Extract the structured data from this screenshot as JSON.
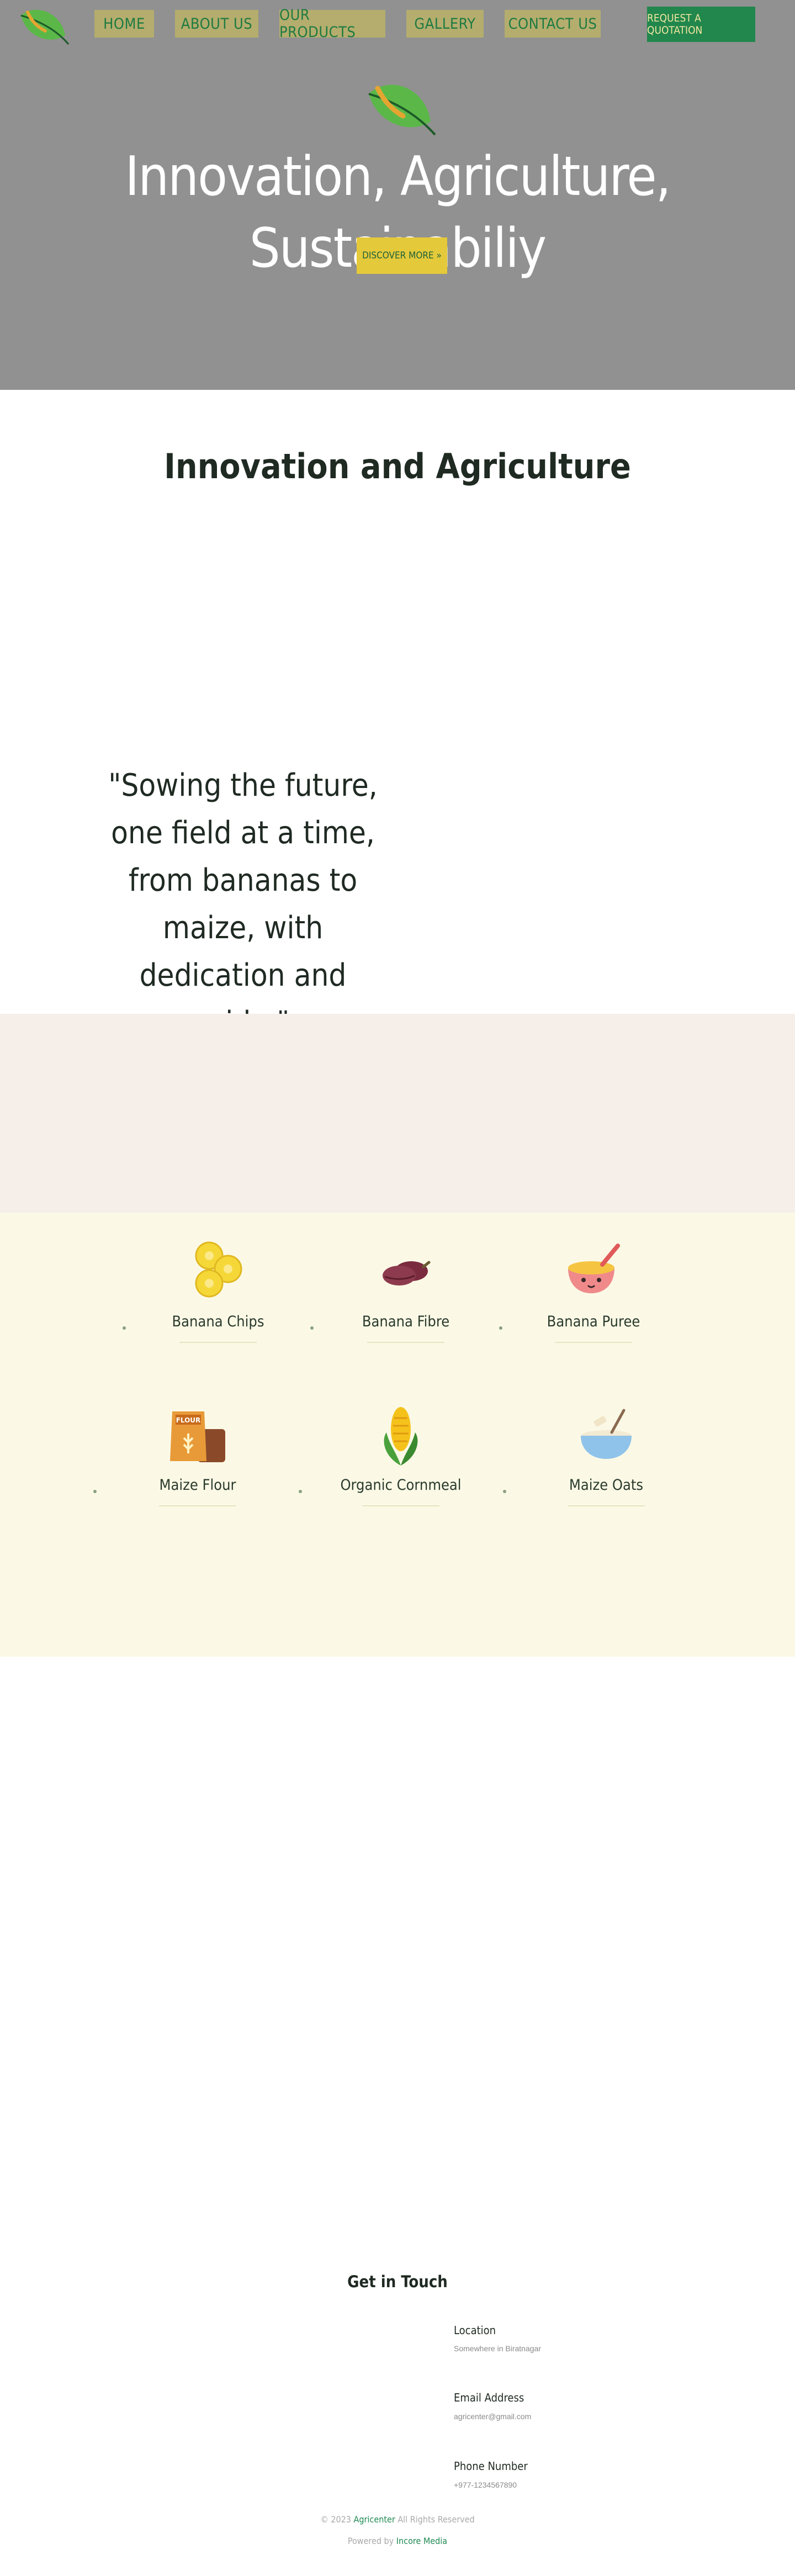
{
  "nav": {
    "items": [
      "Home",
      "About Us",
      "Our Products",
      "Gallery",
      "Contact Us"
    ],
    "cta": "Request A Quotation"
  },
  "hero": {
    "title": "Innovation, Agriculture, Sustainabiliy",
    "button": "Discover More »"
  },
  "innovation": {
    "title": "Innovation and Agriculture",
    "quote": "\"Sowing the future, one field at a time, from bananas to maize, with dedication and pride.\""
  },
  "products": [
    {
      "name": "Banana Chips",
      "icon": "banana-chips-icon"
    },
    {
      "name": "Banana Fibre",
      "icon": "banana-fibre-icon"
    },
    {
      "name": "Banana Puree",
      "icon": "banana-puree-icon"
    },
    {
      "name": "Maize Flour",
      "icon": "maize-flour-icon"
    },
    {
      "name": "Organic Cornmeal",
      "icon": "corn-icon"
    },
    {
      "name": "Maize Oats",
      "icon": "oats-bowl-icon"
    }
  ],
  "contact": {
    "title": "Get in Touch",
    "location_label": "Location",
    "location_value": "Somewhere in Biratnagar",
    "email_label": "Email Address",
    "email_value": "agricenter@gmail.com",
    "phone_label": "Phone Number",
    "phone_value": "+977-1234567890"
  },
  "footer": {
    "copyright_prefix": "© 2023",
    "brand": "Agricenter",
    "copyright_suffix": "All Rights Reserved",
    "powered_prefix": "Powered by",
    "powered_by": "Incore Media"
  },
  "colors": {
    "hero_bg": "#919191",
    "nav_item_bg": "#b4ad6d",
    "accent_green": "#21874c",
    "cta_yellow": "#e4c93a",
    "band_beige": "#f5eee9",
    "band_cream": "#fbf9e6"
  }
}
